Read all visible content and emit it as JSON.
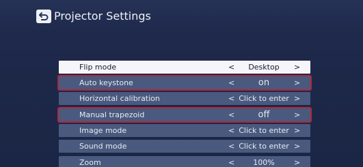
{
  "header": {
    "title": "Projector Settings",
    "back_icon": "back-arrow-icon"
  },
  "menu": {
    "items": [
      {
        "label": "Flip mode",
        "value": "Desktop",
        "selected": true,
        "highlighted": false
      },
      {
        "label": "Auto keystone",
        "value": "on",
        "selected": false,
        "highlighted": true
      },
      {
        "label": "Horizontal calibration",
        "value": "Click to enter",
        "selected": false,
        "highlighted": false
      },
      {
        "label": "Manual trapezoid",
        "value": "off",
        "selected": false,
        "highlighted": true
      },
      {
        "label": "Image mode",
        "value": "Click to enter",
        "selected": false,
        "highlighted": false
      },
      {
        "label": "Sound mode",
        "value": "Click to enter",
        "selected": false,
        "highlighted": false
      },
      {
        "label": "Zoom",
        "value": "100%",
        "selected": false,
        "highlighted": false
      }
    ],
    "left_arrow": "<",
    "right_arrow": ">"
  },
  "colors": {
    "background": "#1d2849",
    "row": "#4a5a7e",
    "row_selected": "#f6f6fa",
    "highlight_outline": "#b2263a"
  }
}
